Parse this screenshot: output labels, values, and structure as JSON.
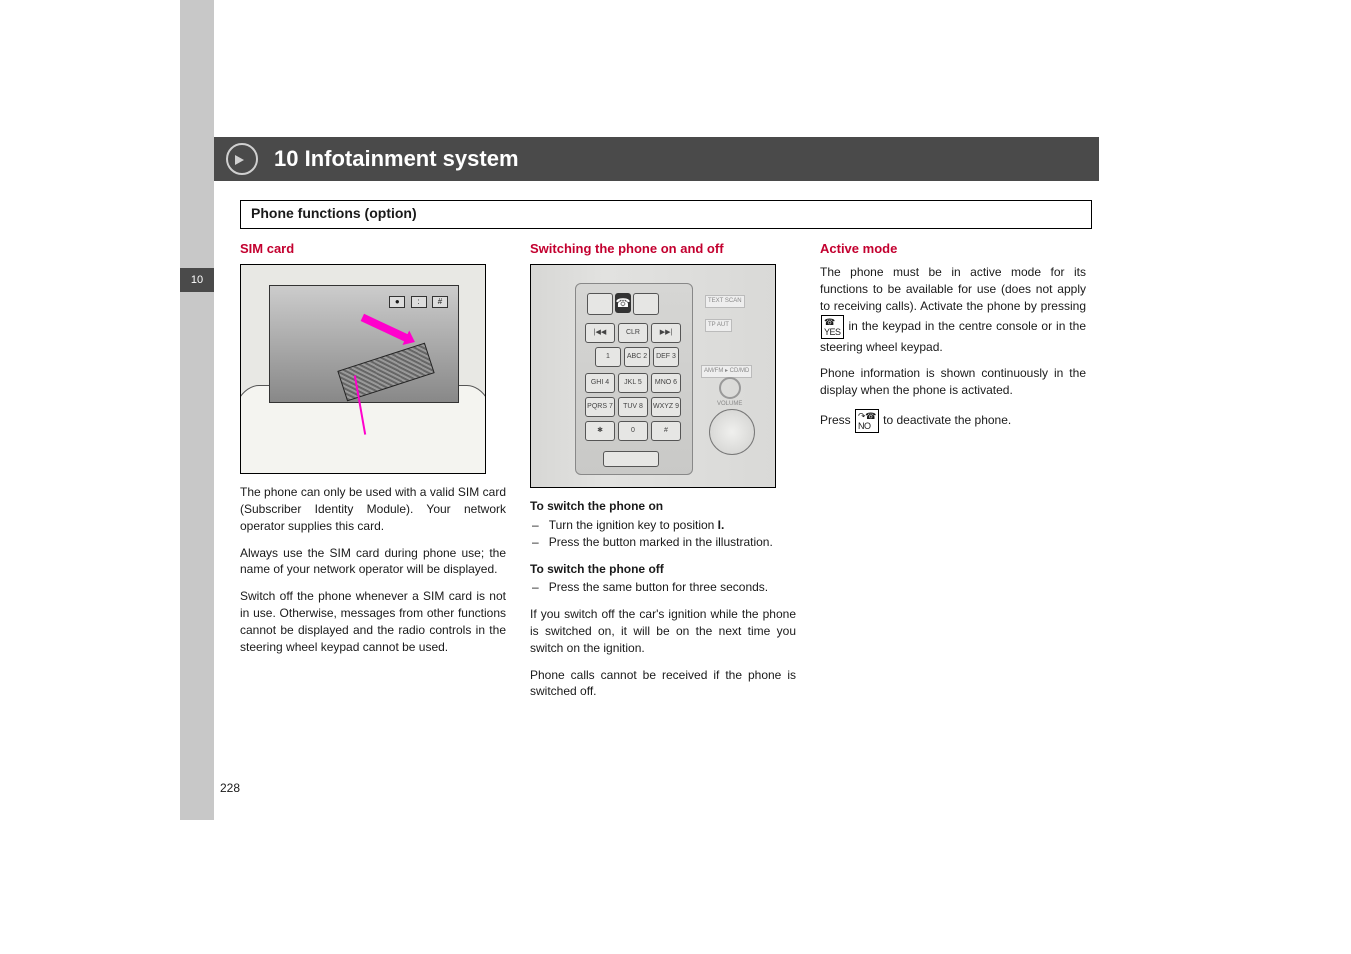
{
  "chapter": {
    "tab": "10",
    "title": "10 Infotainment system"
  },
  "section": "Phone functions (option)",
  "col1": {
    "heading": "SIM card",
    "p1": "The phone can only be used with a valid SIM card (Subscriber Identity Module). Your network operator supplies this card.",
    "p2": "Always use the SIM card during phone use; the name of your network operator will be displayed.",
    "p3": "Switch off the phone whenever a SIM card is not in use. Otherwise, messages from other functions cannot be displayed and the radio controls in the steering wheel keypad cannot be used."
  },
  "col2": {
    "heading": "Switching the phone on and off",
    "on_head": "To switch the phone on",
    "on_items": [
      "Turn the ignition key to position I.",
      "Press the button marked in the illustration."
    ],
    "off_head": "To switch the phone off",
    "off_items": [
      "Press the same button for three seconds."
    ],
    "p_after_off": "If you switch off the car's ignition while the phone is switched on, it will be on the next time you switch on the ignition.",
    "p_last": "Phone calls cannot be received if the phone is switched off."
  },
  "col3": {
    "heading": "Active mode",
    "p1a": "The phone must be in active mode for its functions to be available for use (does not apply to receiving calls). Activate the phone by pressing",
    "p1b": "in the keypad in the centre console or in the steering wheel keypad.",
    "p2": "Phone information is shown continuously in the display when the phone is activated.",
    "p3a": "Press",
    "p3b": "to deactivate the phone."
  },
  "figure1": {
    "mini1": "●",
    "mini2": ":",
    "mini3": "#"
  },
  "figure2": {
    "icon_mid": "☎",
    "row1": [
      "|◀◀",
      "CLR",
      "▶▶|"
    ],
    "row2": [
      "1",
      "ABC 2",
      "DEF 3"
    ],
    "row3": [
      "GHI 4",
      "JKL 5",
      "MNO 6"
    ],
    "row4": [
      "PQRS 7",
      "TUV 8",
      "WXYZ 9"
    ],
    "row5": [
      "✱",
      "0",
      "#"
    ],
    "right_t1": "TEXT  SCAN",
    "right_t2": "TP    AUT",
    "right_t3": "AM/FM ▸ CD/MD",
    "right_t4": "VOLUME"
  },
  "page_number": "228"
}
